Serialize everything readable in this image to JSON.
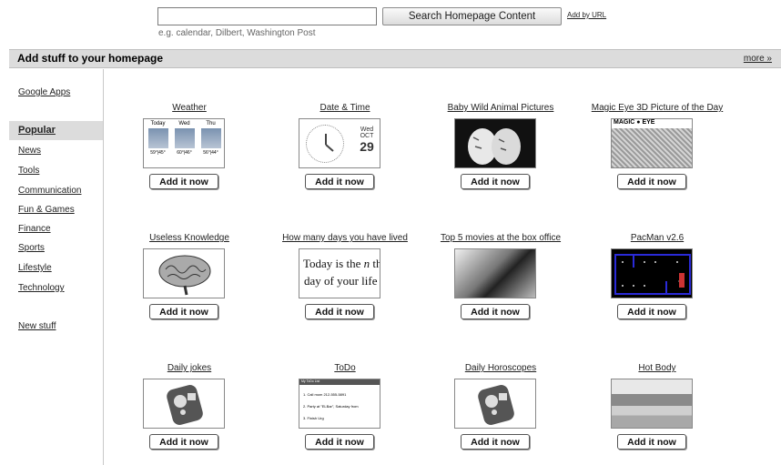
{
  "search": {
    "placeholder": "",
    "button_label": "Search Homepage Content",
    "add_by_url": "Add by URL",
    "hint": "e.g. calendar, Dilbert, Washington Post"
  },
  "header": {
    "title": "Add stuff to your homepage",
    "more": "more »"
  },
  "sidebar": {
    "google_apps": "Google Apps",
    "items": [
      "Popular",
      "News",
      "Tools",
      "Communication",
      "Fun & Games",
      "Finance",
      "Sports",
      "Lifestyle",
      "Technology"
    ],
    "new_stuff": "New stuff"
  },
  "add_label": "Add it now",
  "gadgets": [
    {
      "title": "Weather",
      "icon": "weather-thumbnail"
    },
    {
      "title": "Date & Time",
      "icon": "clock-thumbnail"
    },
    {
      "title": "Baby Wild Animal Pictures",
      "icon": "tiger-cubs-thumbnail"
    },
    {
      "title": "Magic Eye 3D Picture of the Day",
      "icon": "magic-eye-thumbnail"
    },
    {
      "title": "Useless Knowledge",
      "icon": "brain-thumbnail"
    },
    {
      "title": "How many days you have lived",
      "icon": "text-thumbnail"
    },
    {
      "title": "Top 5 movies at the box office",
      "icon": "film-reel-thumbnail"
    },
    {
      "title": "PacMan v2.6",
      "icon": "pacman-thumbnail"
    },
    {
      "title": "Daily jokes",
      "icon": "gadget-icon-thumbnail"
    },
    {
      "title": "ToDo",
      "icon": "todo-list-thumbnail"
    },
    {
      "title": "Daily Horoscopes",
      "icon": "gadget-icon-thumbnail"
    },
    {
      "title": "Hot Body",
      "icon": "beach-thumbnail"
    }
  ],
  "thumbs": {
    "weather": {
      "days": [
        "Today",
        "Wed",
        "Thu"
      ],
      "temps": [
        "59°|45°",
        "60°|46°",
        "56°|44°"
      ]
    },
    "datetime": {
      "day": "Wed",
      "month": "OCT",
      "date": "29"
    },
    "magic_eye_label": "MAGIC ● EYE",
    "days_lived": {
      "line1": "Today is the",
      "n": "n",
      "th": " th",
      "line2": "day of your life"
    },
    "todo": {
      "header": "My ToDo List",
      "items": [
        "1. Call mom 212-555-5891",
        "2. Party at \"ELBar\", Saturday from",
        "3. Finish Urg"
      ]
    }
  },
  "colors": {
    "header_bg": "#dcdcdc",
    "pacman_bg": "#000000",
    "pacman_walls": "#2a2ad8"
  }
}
